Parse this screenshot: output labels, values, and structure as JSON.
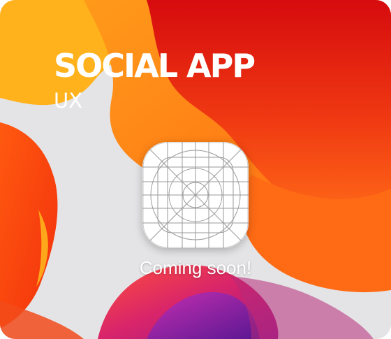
{
  "app": {
    "title": "SOCIAL APP",
    "subtitle": "UX",
    "status": "Coming soon!",
    "icon": "app-icon-template-grid"
  },
  "colors": {
    "background": "#e4e4e6",
    "wallpaper_red": "#d80d10",
    "wallpaper_orange": "#ff6a14",
    "wallpaper_yellow": "#ffb31c",
    "wallpaper_pink": "#c42478",
    "wallpaper_purple": "#7b1aa6",
    "text": "#ffffff",
    "grid_line": "#9a9a9a"
  }
}
